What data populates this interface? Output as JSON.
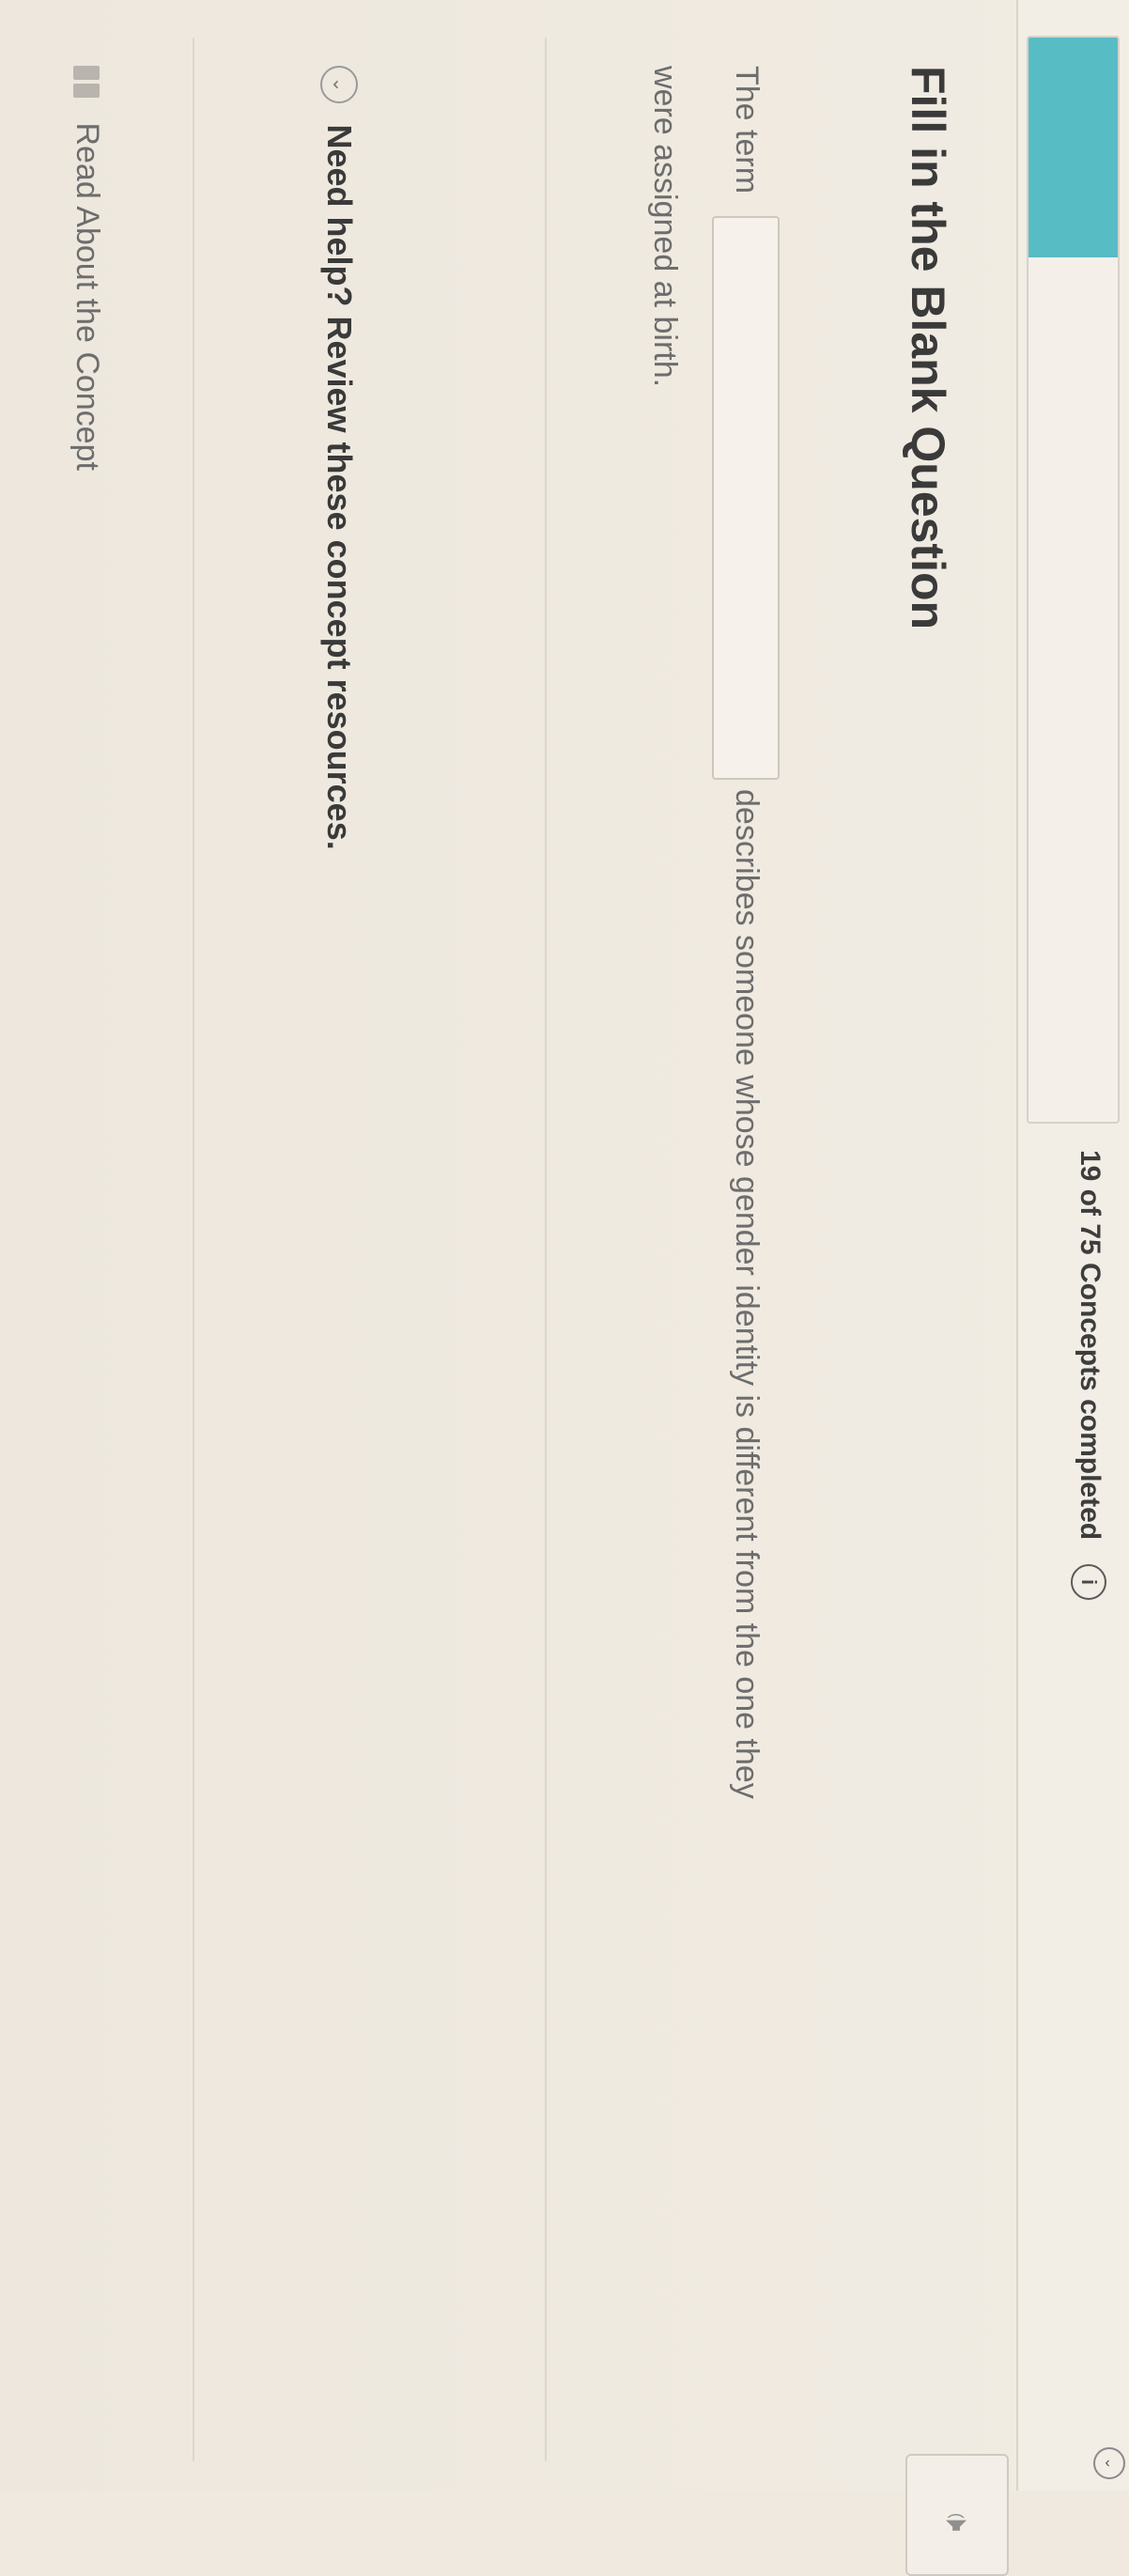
{
  "progress": {
    "text": "19 of 75 Concepts completed",
    "completed": 19,
    "total": 75,
    "fill_fraction": 0.253
  },
  "icons": {
    "info": "i",
    "expand": "⌄",
    "chevron": "⌄",
    "audio": "🕩"
  },
  "question": {
    "title": "Fill in the Blank Question",
    "sentence_start": "The term",
    "blank_value": "",
    "sentence_end_line1": "describes someone whose gender identity is different from the one they",
    "sentence_line2": "were assigned at birth."
  },
  "help": {
    "label": "Need help? Review these concept resources."
  },
  "resources": [
    {
      "label": "Read About the Concept"
    }
  ],
  "colors": {
    "progress_fill": "#58bcc4",
    "background": "#efe9e0"
  }
}
